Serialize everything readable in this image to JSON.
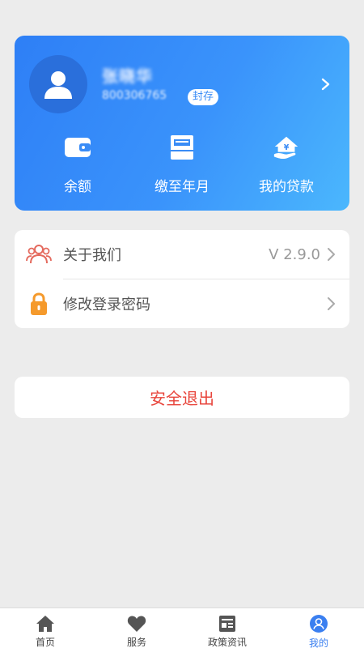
{
  "profile": {
    "name": "张晓华",
    "account_id": "800306765",
    "status_badge": "封存",
    "quick_actions": [
      {
        "label": "余额",
        "icon": "wallet-icon"
      },
      {
        "label": "缴至年月",
        "icon": "printer-icon"
      },
      {
        "label": "我的贷款",
        "icon": "house-loan-icon"
      }
    ]
  },
  "menu": {
    "items": [
      {
        "label": "关于我们",
        "value": "V 2.9.0",
        "icon": "users-icon"
      },
      {
        "label": "修改登录密码",
        "value": "",
        "icon": "lock-icon"
      }
    ]
  },
  "logout": {
    "label": "安全退出"
  },
  "tabbar": {
    "tabs": [
      {
        "label": "首页",
        "icon": "home-icon"
      },
      {
        "label": "服务",
        "icon": "heart-icon"
      },
      {
        "label": "政策资讯",
        "icon": "news-icon"
      },
      {
        "label": "我的",
        "icon": "profile-icon",
        "active": true
      }
    ]
  },
  "colors": {
    "card_gradient_start": "#2e7ff6",
    "card_gradient_end": "#4bb7fd",
    "logout_text": "#e8453c",
    "active_tab": "#3a7ff0",
    "lock_orange": "#f59a2c",
    "users_red": "#e46a5e"
  }
}
